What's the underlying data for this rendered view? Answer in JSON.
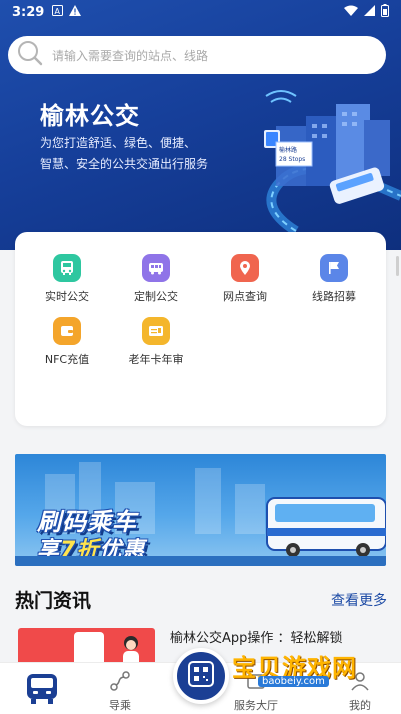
{
  "status_bar": {
    "time": "3:29"
  },
  "search": {
    "placeholder": "请输入需要查询的站点、线路"
  },
  "hero": {
    "title": "榆林公交",
    "slogan_line1": "为您打造舒适、绿色、便捷、",
    "slogan_line2": "智慧、安全的公共交通出行服务",
    "sign_text": "榆林路\n28 Stops"
  },
  "services": [
    {
      "label": "实时公交",
      "icon": "bus-icon",
      "color": "#2ec7a0"
    },
    {
      "label": "定制公交",
      "icon": "custom-bus-icon",
      "color": "#8f74e8"
    },
    {
      "label": "网点查询",
      "icon": "location-pin-icon",
      "color": "#f0654f"
    },
    {
      "label": "线路招募",
      "icon": "flag-icon",
      "color": "#5b86e8"
    },
    {
      "label": "NFC充值",
      "icon": "wallet-icon",
      "color": "#f4a52b"
    },
    {
      "label": "老年卡年审",
      "icon": "card-icon",
      "color": "#f4b62c"
    }
  ],
  "banner": {
    "line1": "刷码乘车",
    "line2_pre": "享",
    "line2_hl": "7折",
    "line2_post": "优惠"
  },
  "news": {
    "heading": "热门资讯",
    "more": "查看更多",
    "item_title": "榆林公交App操作      ：轻松解锁            "
  },
  "tabs": [
    {
      "label": "",
      "icon": "bus-home-icon"
    },
    {
      "label": "导乘",
      "icon": "route-icon"
    },
    {
      "label": "",
      "icon": "qr-scan-icon"
    },
    {
      "label": "服务大厅",
      "icon": "service-hall-icon"
    },
    {
      "label": "我的",
      "icon": "profile-icon"
    }
  ],
  "watermark": {
    "text": "宝贝游戏网",
    "url": "baobeiy.com"
  },
  "colors": {
    "primary": "#1b3f94",
    "hero_bg": "#163f9a",
    "accent_link": "#1c4aa5"
  }
}
